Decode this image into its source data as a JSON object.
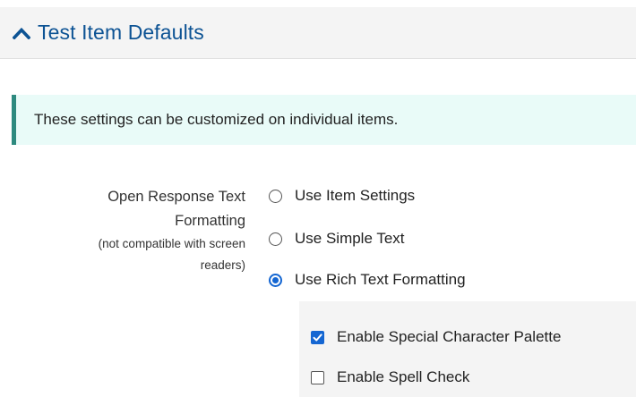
{
  "section": {
    "title": "Test Item Defaults",
    "expanded": true,
    "chevron_icon": "chevron-up-icon"
  },
  "info": {
    "text": "These settings can be customized on individual items."
  },
  "setting": {
    "label_line1": "Open Response Text",
    "label_line2": "Formatting",
    "note_line1": "(not compatible with screen",
    "note_line2": "readers)",
    "options": [
      {
        "label": "Use Item Settings",
        "selected": false
      },
      {
        "label": "Use Simple Text",
        "selected": false
      },
      {
        "label": "Use Rich Text Formatting",
        "selected": true
      }
    ],
    "rich_text_options": [
      {
        "label": "Enable Special Character Palette",
        "checked": true
      },
      {
        "label": "Enable Spell Check",
        "checked": false
      }
    ]
  },
  "colors": {
    "accent": "#1466d2",
    "header_title": "#0d5394",
    "info_border": "#2e8a7f",
    "info_background": "#e9fbf8"
  }
}
